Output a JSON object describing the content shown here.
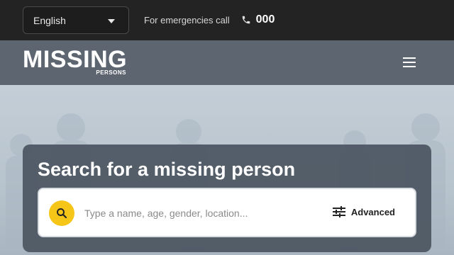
{
  "topbar": {
    "language": "English",
    "emergency_label": "For emergencies call",
    "emergency_number": "000"
  },
  "navbar": {
    "logo_main": "MISSING",
    "logo_sub": "PERSONS"
  },
  "search": {
    "title": "Search for a missing person",
    "placeholder": "Type a name, age, gender, location...",
    "advanced_label": "Advanced"
  },
  "colors": {
    "accent": "#f5c518",
    "topbar_bg": "#232323",
    "navbar_bg": "#5d6570",
    "card_bg": "#4b5561"
  },
  "icons": [
    "chevron-down-icon",
    "phone-icon",
    "menu-icon",
    "search-icon",
    "sliders-icon"
  ]
}
